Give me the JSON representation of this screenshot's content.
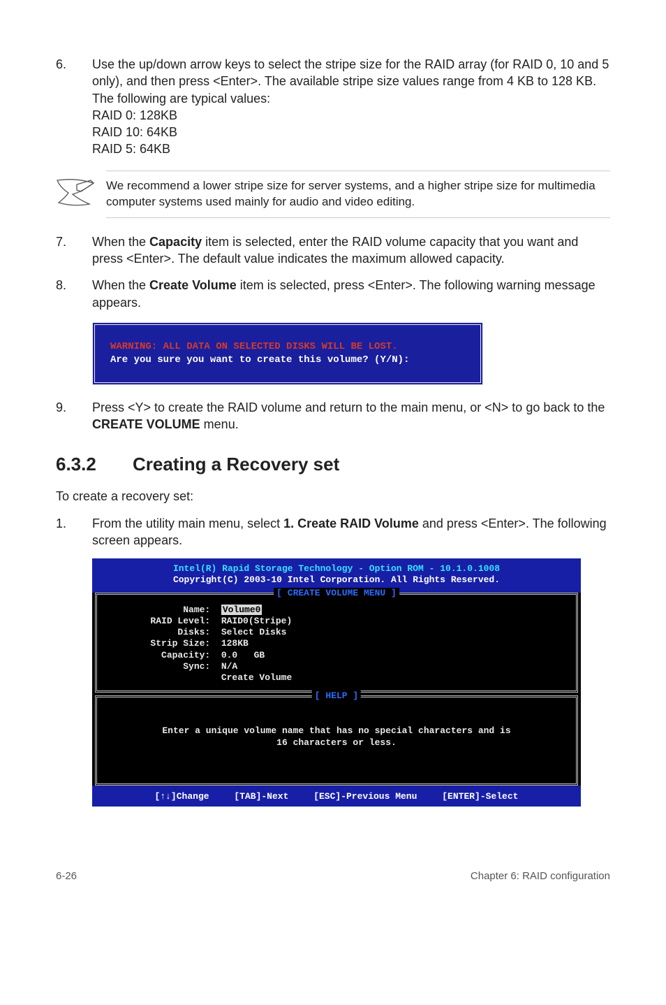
{
  "step6": {
    "num": "6.",
    "text_a": "Use the up/down arrow keys to select the stripe size for the RAID array (for RAID 0, 10 and 5 only), and then press <Enter>. The available stripe size values range from 4 KB to 128 KB. The following are typical values:",
    "l1": "RAID 0: 128KB",
    "l2": "RAID 10: 64KB",
    "l3": "RAID 5: 64KB"
  },
  "note": "We recommend a lower stripe size for server systems, and a higher stripe size for multimedia computer systems used mainly for audio and video editing.",
  "step7": {
    "num": "7.",
    "text_a": "When the ",
    "bold": "Capacity",
    "text_b": " item is selected, enter the RAID volume capacity that you want and press <Enter>. The default value indicates the maximum allowed capacity."
  },
  "step8": {
    "num": "8.",
    "text_a": "When the ",
    "bold": "Create Volume",
    "text_b": " item is selected, press <Enter>. The following warning message appears."
  },
  "warn": {
    "l1": "WARNING: ALL DATA ON SELECTED DISKS WILL BE LOST.",
    "l2": "Are you sure you want to create this volume? (Y/N):"
  },
  "step9": {
    "num": "9.",
    "text_a": "Press <Y> to create the RAID volume and return to the main menu, or <N> to go back to the ",
    "bold": "CREATE VOLUME",
    "text_b": " menu."
  },
  "heading": {
    "num": "6.3.2",
    "title": "Creating a Recovery set"
  },
  "intro": "To create a recovery set:",
  "step1": {
    "num": "1.",
    "text_a": "From the utility main menu, select ",
    "bold": "1. Create RAID Volume",
    "text_b": " and press <Enter>. The following screen appears."
  },
  "bios": {
    "title_line1": "Intel(R) Rapid Storage Technology - Option ROM - 10.1.0.1008",
    "title_line2": "Copyright(C) 2003-10 Intel Corporation.  All Rights Reserved.",
    "menu_title": "[ CREATE VOLUME MENU ]",
    "rows": {
      "name_k": "              Name:  ",
      "name_v": "Volume0",
      "raid": "        RAID Level:  RAID0(Stripe)",
      "disks": "             Disks:  Select Disks",
      "strip": "        Strip Size:  128KB",
      "cap": "          Capacity:  0.0   GB",
      "sync": "              Sync:  N/A",
      "create": "                     Create Volume"
    },
    "help_title": "[ HELP ]",
    "help_l1": "Enter a unique volume name that has no special characters and is",
    "help_l2": "16 characters or less.",
    "footer": {
      "change": "[↑↓]Change",
      "next": "[TAB]-Next",
      "prev": "[ESC]-Previous Menu",
      "select": "[ENTER]-Select"
    }
  },
  "footer": {
    "left": "6-26",
    "right": "Chapter 6: RAID configuration"
  }
}
